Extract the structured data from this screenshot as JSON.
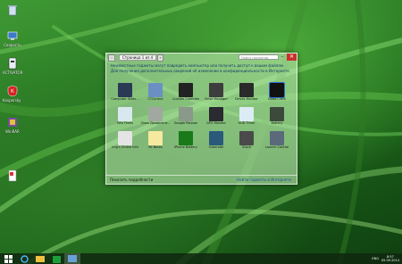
{
  "desktop": {
    "icons": [
      {
        "label": "",
        "icon": "recycle-bin-icon"
      },
      {
        "label": "Скорость",
        "icon": "network-icon"
      },
      {
        "label": "ACTIVATOR",
        "icon": "activator-icon"
      },
      {
        "label": "Kaspersky CleanMaster",
        "icon": "kaspersky-icon"
      },
      {
        "label": "WinRAR",
        "icon": "winrar-icon"
      },
      {
        "label": "",
        "icon": "file-icon"
      }
    ]
  },
  "gallery": {
    "page_indicator": "Страница 1 из 4",
    "search_placeholder": "Поиск гаджетов",
    "info_text": "Неизвестные гаджеты могут повредить компьютер или получить доступ к вашим файлам. Для получения дополнительных сведений об изменении в конфиденциальности в Интернете.",
    "gadgets": [
      {
        "label": "Computer Statu...",
        "color": "#2a3a55"
      },
      {
        "label": "CTControl",
        "color": "#6b8fc2"
      },
      {
        "label": "Custom Calendar",
        "color": "#222222"
      },
      {
        "label": "Drive Manager",
        "color": "#3d3d3d"
      },
      {
        "label": "Drives Monitor",
        "color": "#2a2a2a"
      },
      {
        "label": "Glass Clock",
        "color": "#111111"
      },
      {
        "label": "Geo Feeds",
        "color": "#d8e8ee"
      },
      {
        "label": "Glass Диафрагм...",
        "color": "#a0a8a0"
      },
      {
        "label": "Google Poisson",
        "color": "#8a9a8a"
      },
      {
        "label": "GPU Monitor",
        "color": "#2a2a30"
      },
      {
        "label": "HUD Timer",
        "color": "#dcecf5"
      },
      {
        "label": "Battery",
        "color": "#3c4a3c"
      },
      {
        "label": "Img's Online Info",
        "color": "#e4e4e4"
      },
      {
        "label": "Mr.Notes",
        "color": "#f5e9a0"
      },
      {
        "label": "iPhone Battery",
        "color": "#1a7a1a"
      },
      {
        "label": "iCalendar",
        "color": "#2a5a7a"
      },
      {
        "label": "iClock",
        "color": "#4a4a4a"
      },
      {
        "label": "Launch Control",
        "color": "#5a6a7a"
      }
    ],
    "selected_index": 5,
    "show_details_label": "Показать подробности",
    "online_link": "Найти гаджеты в Интернете"
  },
  "taskbar": {
    "items": [
      "start-icon",
      "ie-icon",
      "explorer-icon",
      "store-icon",
      "gadgets-icon"
    ],
    "tray_lang": "ENG",
    "time": "8:57",
    "date": "05.09.2014"
  }
}
